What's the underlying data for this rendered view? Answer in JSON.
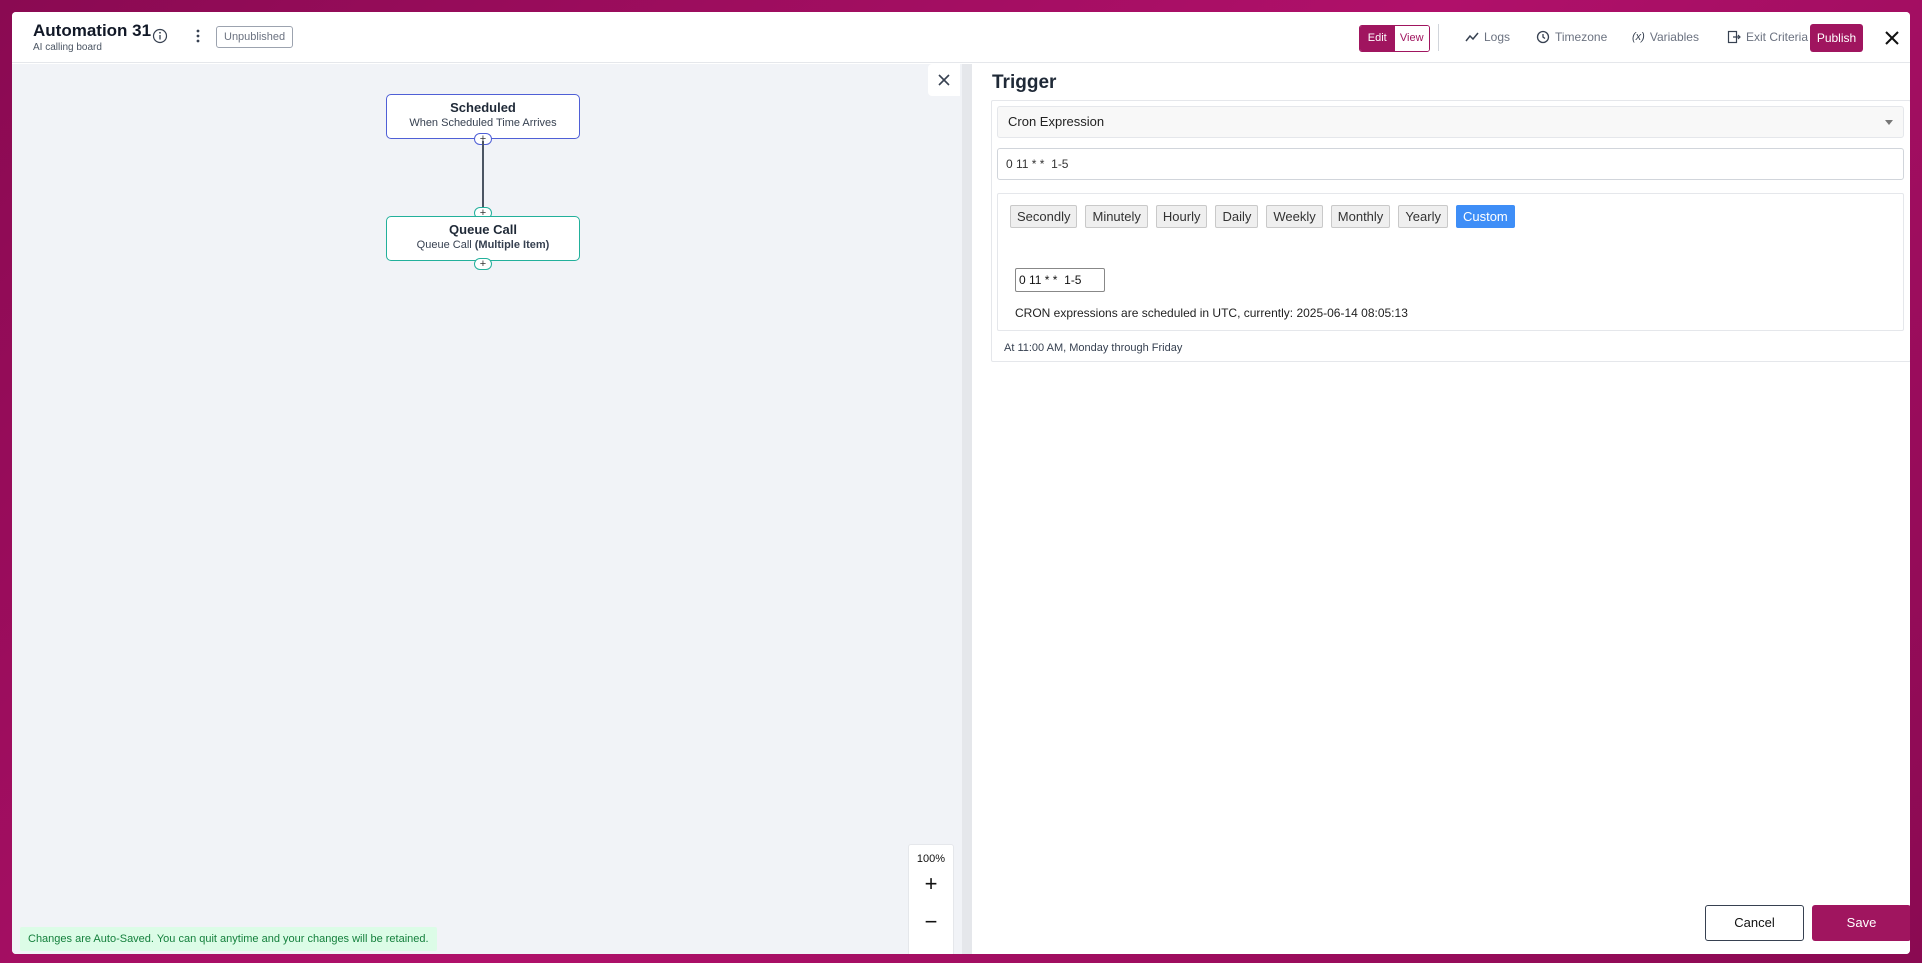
{
  "header": {
    "title": "Automation 31",
    "subtitle": "AI calling board",
    "status_badge": "Unpublished",
    "mode_toggle": {
      "edit": "Edit",
      "view": "View",
      "active": "Edit"
    },
    "links": {
      "logs": "Logs",
      "timezone": "Timezone",
      "variables": "Variables",
      "exit_criteria": "Exit Criteria"
    },
    "publish": "Publish"
  },
  "canvas": {
    "nodes": [
      {
        "title": "Scheduled",
        "subtitle": "When Scheduled Time Arrives"
      },
      {
        "title": "Queue Call",
        "subtitle_plain": "Queue Call ",
        "subtitle_bold": "(Multiple Item)"
      }
    ],
    "zoom": {
      "level": "100%",
      "in": "+",
      "out": "−"
    },
    "autosave_note": "Changes are Auto-Saved. You can quit anytime and your changes will be retained."
  },
  "panel": {
    "title": "Trigger",
    "trigger_type": "Cron Expression",
    "cron_value": "0 11 * *  1-5",
    "presets": [
      "Secondly",
      "Minutely",
      "Hourly",
      "Daily",
      "Weekly",
      "Monthly",
      "Yearly",
      "Custom"
    ],
    "active_preset": "Custom",
    "custom_value": "0 11 * *  1-5",
    "utc_note": "CRON expressions are scheduled in UTC, currently: 2025-06-14 08:05:13",
    "human_readable": "At 11:00 AM, Monday through Friday",
    "cancel": "Cancel",
    "save": "Save"
  },
  "colors": {
    "brand": "#a0155f",
    "scheduled_border": "#4f5fd6",
    "queue_border": "#22b09b",
    "preset_active": "#3e8ef7",
    "autosave_bg": "#dcfce7"
  }
}
